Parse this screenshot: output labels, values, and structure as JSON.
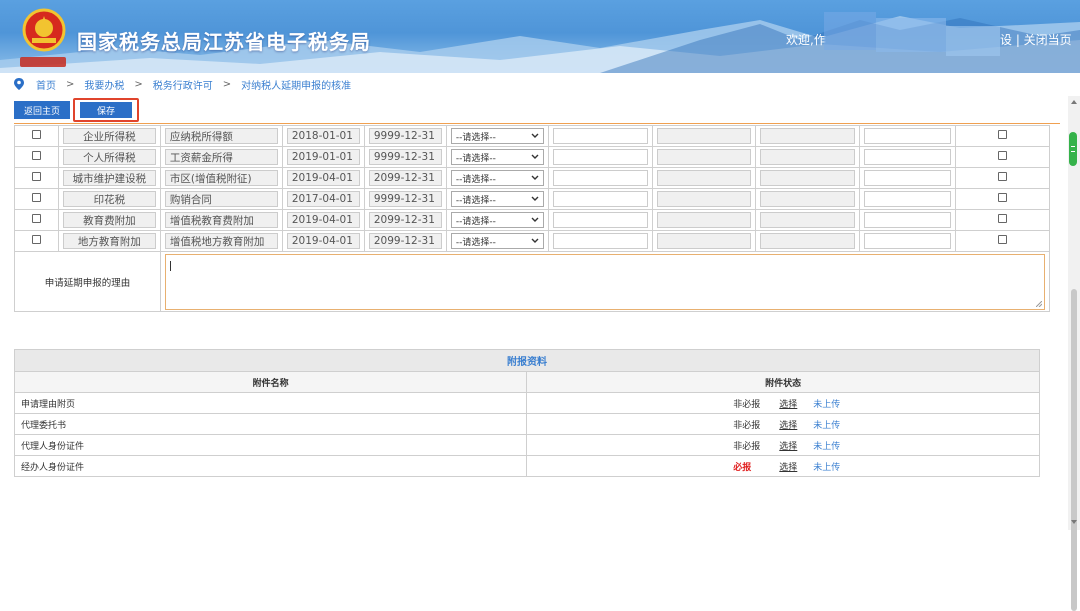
{
  "header": {
    "site_title": "国家税务总局江苏省电子税务局",
    "welcome": "欢迎,作",
    "links": "设 | 关闭当页",
    "logo_text": "中国税务",
    "colors": {
      "header_blue": "#4f95d8",
      "button_blue": "#2b6fc7",
      "link_blue": "#3a7fd0",
      "highlight_red": "#e0442c",
      "required_red": "#e02020"
    }
  },
  "breadcrumb": {
    "items": [
      "首页",
      "我要办税",
      "税务行政许可",
      "对纳税人延期申报的核准"
    ],
    "separator": ">"
  },
  "toolbar": {
    "home_label": "返回主页",
    "save_label": "保存"
  },
  "rows": [
    {
      "tax": "企业所得税",
      "item": "应纳税所得额",
      "start": "2018-01-01",
      "end": "9999-12-31",
      "select": "--请选择--"
    },
    {
      "tax": "个人所得税",
      "item": "工资薪金所得",
      "start": "2019-01-01",
      "end": "9999-12-31",
      "select": "--请选择--"
    },
    {
      "tax": "城市维护建设税",
      "item": "市区(增值税附征)",
      "start": "2019-04-01",
      "end": "2099-12-31",
      "select": "--请选择--"
    },
    {
      "tax": "印花税",
      "item": "购销合同",
      "start": "2017-04-01",
      "end": "9999-12-31",
      "select": "--请选择--"
    },
    {
      "tax": "教育费附加",
      "item": "增值税教育费附加",
      "start": "2019-04-01",
      "end": "2099-12-31",
      "select": "--请选择--"
    },
    {
      "tax": "地方教育附加",
      "item": "增值税地方教育附加",
      "start": "2019-04-01",
      "end": "2099-12-31",
      "select": "--请选择--"
    }
  ],
  "reason": {
    "label": "申请延期申报的理由",
    "value": ""
  },
  "attachments": {
    "title": "附报资料",
    "col_name": "附件名称",
    "col_status": "附件状态",
    "items": [
      {
        "name": "申请理由附页",
        "required": "非必报",
        "choose": "选择",
        "status": "未上传"
      },
      {
        "name": "代理委托书",
        "required": "非必报",
        "choose": "选择",
        "status": "未上传"
      },
      {
        "name": "代理人身份证件",
        "required": "非必报",
        "choose": "选择",
        "status": "未上传"
      },
      {
        "name": "经办人身份证件",
        "required": "必报",
        "choose": "选择",
        "status": "未上传"
      }
    ]
  },
  "icons": {
    "breadcrumb": "location-pin-icon",
    "scroll_up": "arrow-up-icon",
    "scroll_down": "arrow-down-icon",
    "select": "chevron-down-icon"
  }
}
